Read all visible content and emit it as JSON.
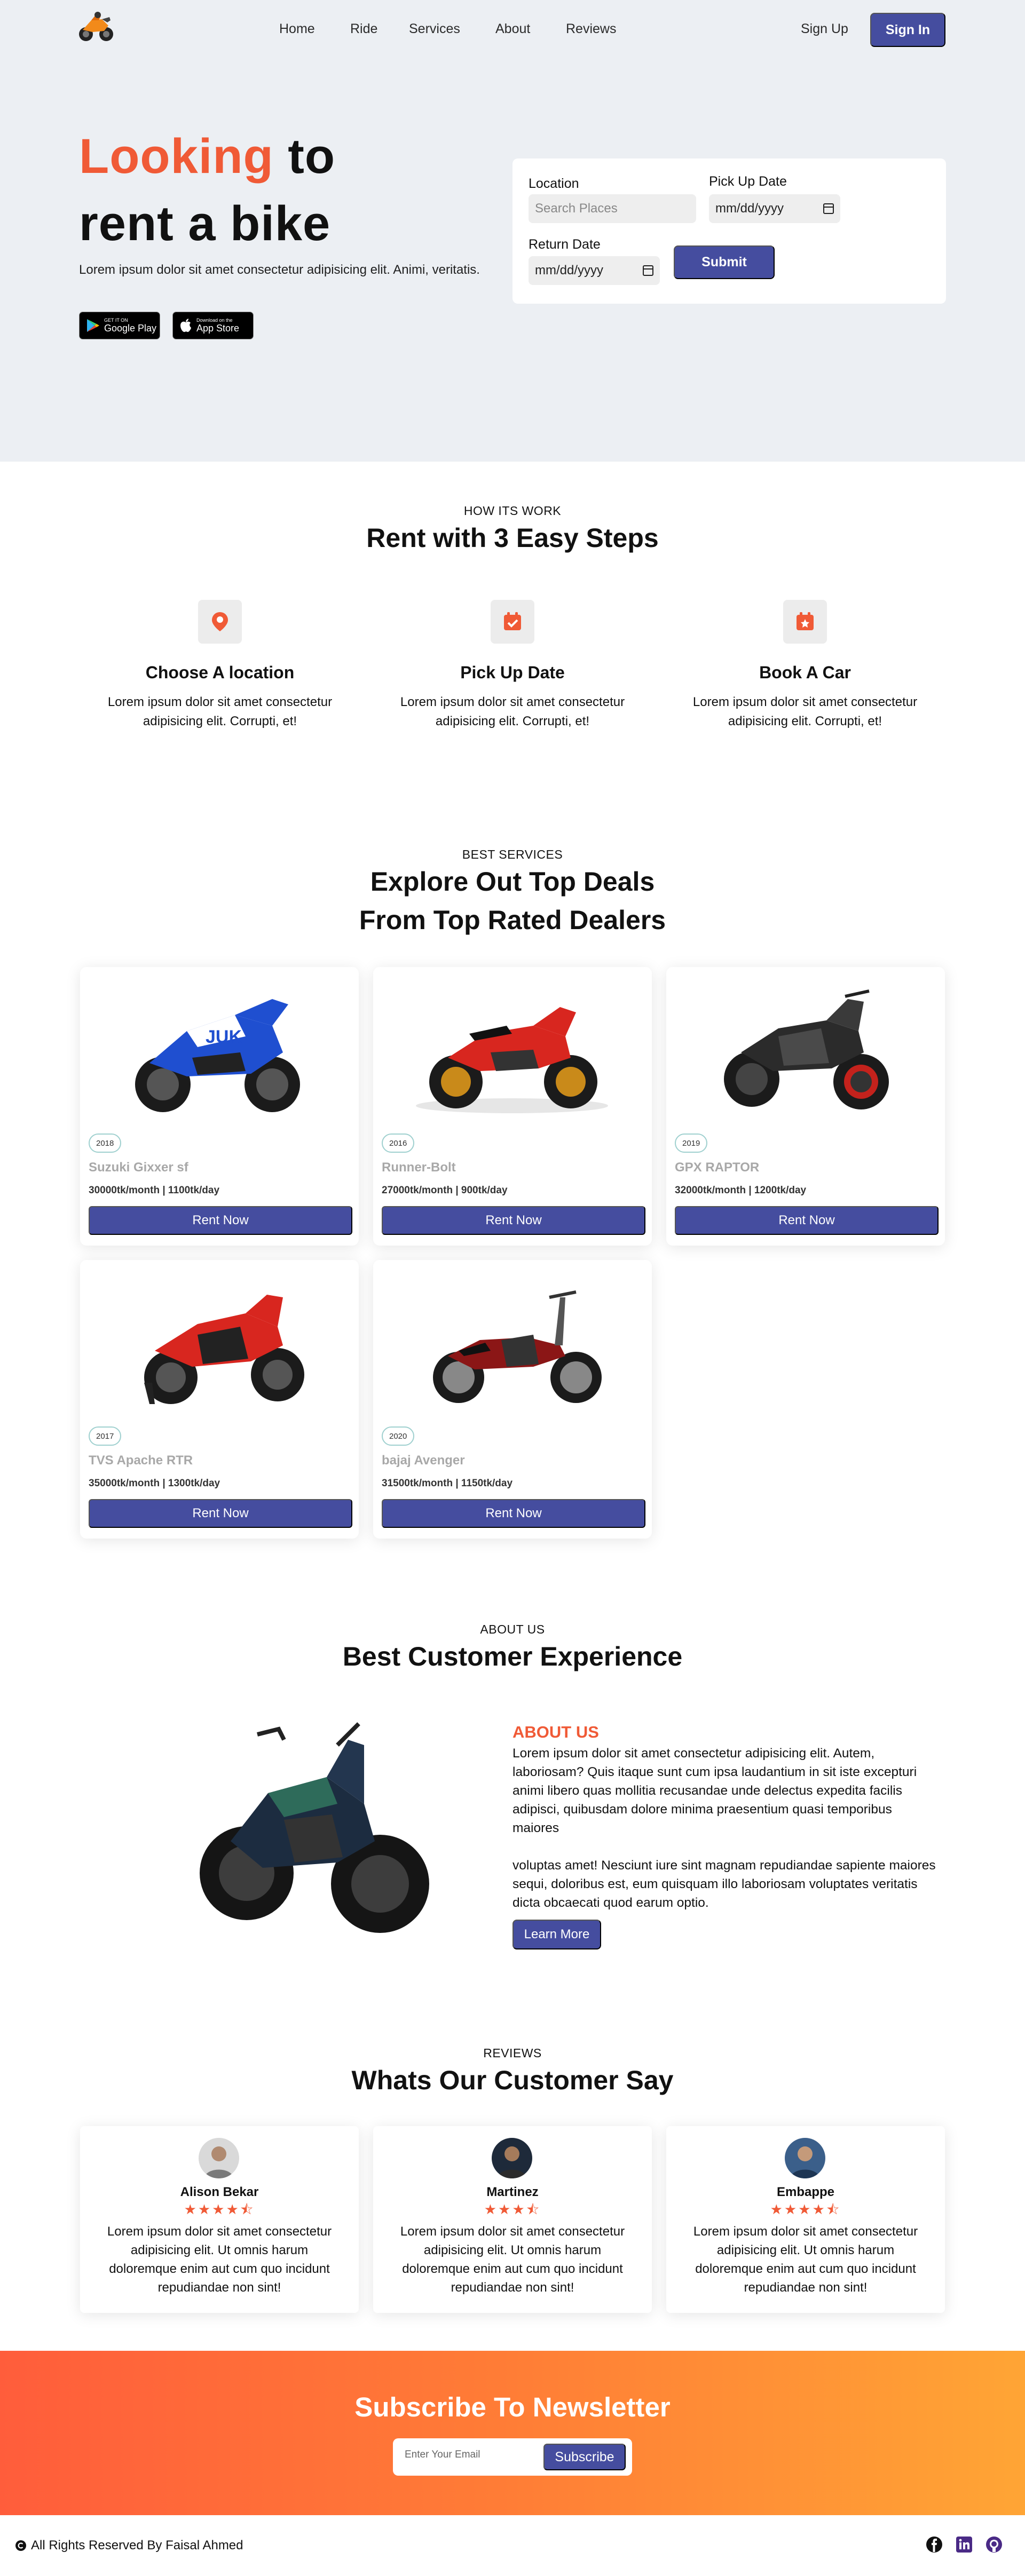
{
  "nav": {
    "links": [
      "Home",
      "Ride",
      "Services",
      "About",
      "Reviews"
    ],
    "signup": "Sign Up",
    "signin": "Sign In"
  },
  "hero": {
    "title_accent": "Looking",
    "title_rest_1": " to",
    "title_line_2": "rent a bike",
    "subtitle": "Lorem ipsum dolor sit amet consectetur adipisicing elit. Animi, veritatis.",
    "google_play": {
      "small": "GET IT ON",
      "big": "Google Play"
    },
    "app_store": {
      "small": "Download on the",
      "big": "App Store"
    }
  },
  "search": {
    "location_label": "Location",
    "location_placeholder": "Search Places",
    "pickup_label": "Pick Up Date",
    "pickup_value": "mm/dd/yyyy",
    "return_label": "Return Date",
    "return_value": "mm/dd/yyyy",
    "submit": "Submit"
  },
  "how": {
    "eyebrow": "HOW ITS WORK",
    "title": "Rent with 3 Easy Steps",
    "steps": [
      {
        "title": "Choose A location",
        "desc": "Lorem ipsum dolor sit amet consectetur adipisicing elit. Corrupti, et!",
        "icon": "location-pin-icon"
      },
      {
        "title": "Pick Up Date",
        "desc": "Lorem ipsum dolor sit amet consectetur adipisicing elit. Corrupti, et!",
        "icon": "calendar-check-icon"
      },
      {
        "title": "Book A Car",
        "desc": "Lorem ipsum dolor sit amet consectetur adipisicing elit. Corrupti, et!",
        "icon": "calendar-star-icon"
      }
    ]
  },
  "services": {
    "eyebrow": "BEST SERVICES",
    "title_1": "Explore Out Top Deals",
    "title_2": "From Top Rated Dealers",
    "bikes": [
      {
        "year": "2018",
        "name": "Suzuki Gixxer sf",
        "price": "30000tk/month | 1100tk/day",
        "cta": "Rent Now",
        "color": "#1f4fd0"
      },
      {
        "year": "2016",
        "name": "Runner-Bolt",
        "price": "27000tk/month | 900tk/day",
        "cta": "Rent Now",
        "color": "#d8261f"
      },
      {
        "year": "2019",
        "name": "GPX RAPTOR",
        "price": "32000tk/month | 1200tk/day",
        "cta": "Rent Now",
        "color": "#2b2b2b"
      },
      {
        "year": "2017",
        "name": "TVS Apache RTR",
        "price": "35000tk/month | 1300tk/day",
        "cta": "Rent Now",
        "color": "#d8261f"
      },
      {
        "year": "2020",
        "name": "bajaj Avenger",
        "price": "31500tk/month | 1150tk/day",
        "cta": "Rent Now",
        "color": "#8b1616"
      }
    ]
  },
  "about": {
    "eyebrow": "ABOUT US",
    "title": "Best Customer Experience",
    "heading": "ABOUT US",
    "para_1": "Lorem ipsum dolor sit amet consectetur adipisicing elit. Autem, laboriosam? Quis itaque sunt cum ipsa laudantium in sit iste excepturi animi libero quas mollitia recusandae unde delectus expedita facilis adipisci, quibusdam dolore minima praesentium quasi temporibus maiores",
    "para_2": "voluptas amet! Nesciunt iure sint magnam repudiandae sapiente maiores sequi, doloribus est, eum quisquam illo laboriosam voluptates veritatis dicta obcaecati quod earum optio.",
    "cta": "Learn More"
  },
  "reviews": {
    "eyebrow": "REVIEWS",
    "title": "Whats Our Customer Say",
    "items": [
      {
        "name": "Alison Bekar",
        "stars": "★★★★⯪",
        "text": "Lorem ipsum dolor sit amet consectetur adipisicing elit. Ut omnis harum doloremque enim aut cum quo incidunt repudiandae non sint!"
      },
      {
        "name": "Martinez",
        "stars": "★★★⯪",
        "text": "Lorem ipsum dolor sit amet consectetur adipisicing elit. Ut omnis harum doloremque enim aut cum quo incidunt repudiandae non sint!"
      },
      {
        "name": "Embappe",
        "stars": "★★★★⯪",
        "text": "Lorem ipsum dolor sit amet consectetur adipisicing elit. Ut omnis harum doloremque enim aut cum quo incidunt repudiandae non sint!"
      }
    ]
  },
  "newsletter": {
    "title": "Subscribe To Newsletter",
    "placeholder": "Enter Your Email",
    "cta": "Subscribe"
  },
  "footer": {
    "copyright": "All Rights Reserved By Faisal Ahmed",
    "social": [
      "facebook-icon",
      "linkedin-icon",
      "github-icon"
    ]
  },
  "colors": {
    "accent": "#f05a36",
    "primary": "#454d9f",
    "hero_bg": "#eceff3"
  }
}
